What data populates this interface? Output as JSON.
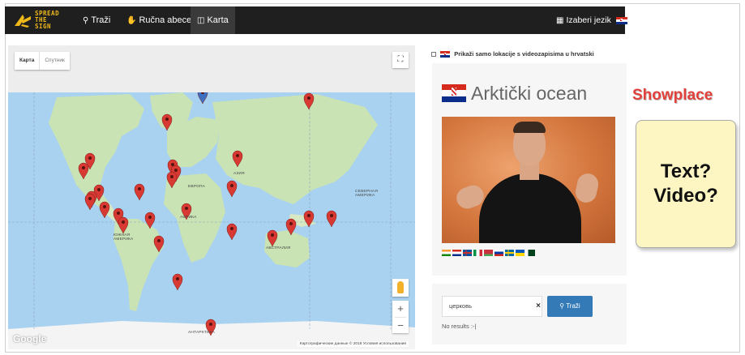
{
  "navbar": {
    "logo_text": "SPREAD THE SIGN",
    "items": [
      {
        "label": "Traži",
        "icon": "search-icon"
      },
      {
        "label": "Ručna abeceda",
        "icon": "hand-icon"
      },
      {
        "label": "Karta",
        "icon": "map-icon",
        "active": true
      }
    ],
    "language": {
      "label": "Izaberi jezik",
      "icon": "language-icon",
      "flag": "croatia-flag"
    }
  },
  "map": {
    "map_types": [
      "Карта",
      "Спутник"
    ],
    "active_map_type": "Карта",
    "place_labels": [
      "АЗИЯ",
      "ЕВРОПА",
      "АФРИКА",
      "СЕВЕРНАЯ АМЕРИКА",
      "ЮЖНАЯ АМЕРИКА",
      "АВСТРАЛИЯ",
      "АНТАРКТИКА"
    ],
    "zoom_in": "+",
    "zoom_out": "−",
    "google_logo": "Google",
    "attribution": "Картографические данные © 2018 Условия использования",
    "marker_color": "#d83a33",
    "selected_marker_color": "#3f6fbf"
  },
  "filter": {
    "label": "Prikaži samo lokacije s videozapisima u hrvatski",
    "checked": false
  },
  "word": {
    "title": "Arktički ocean"
  },
  "video_flags": [
    "india",
    "croatia",
    "iceland",
    "italy",
    "belarus",
    "russia",
    "sweden",
    "ukraine",
    "pakistan"
  ],
  "search": {
    "value": "церковь",
    "clear_icon": "×",
    "button_label": "Traži",
    "no_results": "No results :-|"
  },
  "annotation": {
    "showplace": "Showplace",
    "note_line1": "Text?",
    "note_line2": "Video?"
  },
  "colors": {
    "navbar_bg": "#1f1f1f",
    "logo": "#f0b91a",
    "accent": "#337ab7",
    "annotation_red": "#e2403b",
    "note_bg": "#fdf5c2"
  }
}
